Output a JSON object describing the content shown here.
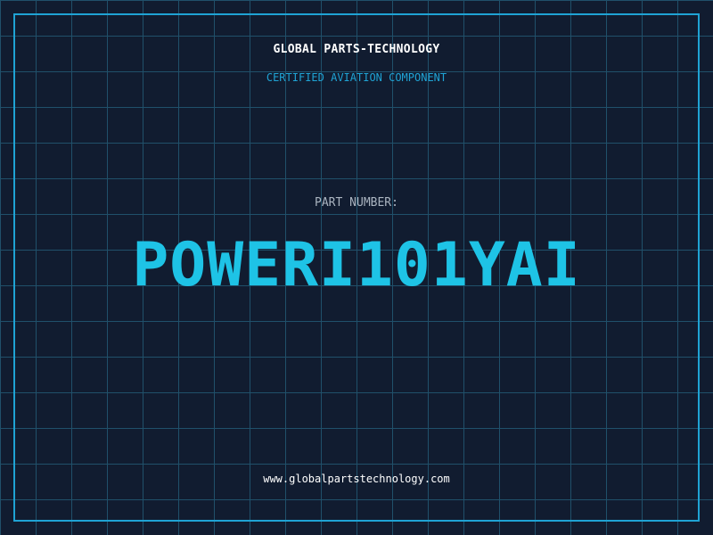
{
  "header": {
    "company": "GLOBAL PARTS-TECHNOLOGY",
    "tagline": "CERTIFIED AVIATION COMPONENT"
  },
  "part": {
    "label": "PART NUMBER:",
    "number": "POWERI101YAI"
  },
  "footer": {
    "website": "www.globalpartstechnology.com"
  },
  "colors": {
    "background": "#111c30",
    "grid": "#20506a",
    "accent": "#1fa3d4",
    "part_number": "#1ec3e6",
    "text": "#ffffff",
    "label": "#aab4c0"
  }
}
